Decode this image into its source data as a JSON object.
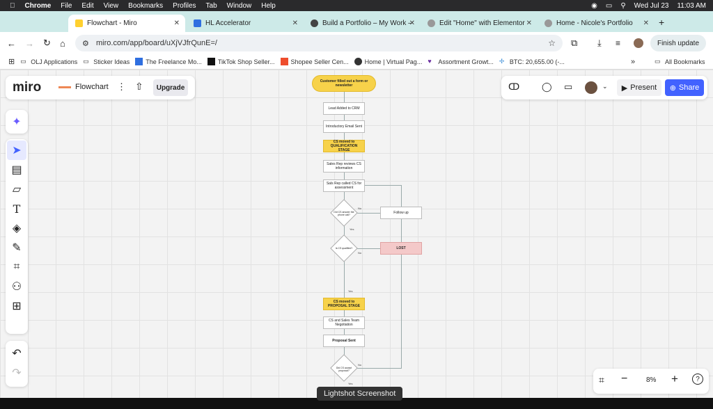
{
  "menubar": {
    "app": "Chrome",
    "items": [
      "File",
      "Edit",
      "View",
      "Bookmarks",
      "Profiles",
      "Tab",
      "Window",
      "Help"
    ],
    "date": "Wed Jul 23",
    "time": "11:03 AM"
  },
  "tabs": [
    {
      "label": "Flowchart - Miro",
      "color": "#ffd02f"
    },
    {
      "label": "HL Accelerator",
      "color": "#2f6fe0"
    },
    {
      "label": "Build a Portfolio – My Work –",
      "color": "#444"
    },
    {
      "label": "Edit \"Home\" with Elementor",
      "color": "#999"
    },
    {
      "label": "Home - Nicole's Portfolio",
      "color": "#999"
    }
  ],
  "toolbar": {
    "url": "miro.com/app/board/uXjVJfrQunE=/",
    "finish_label": "Finish update"
  },
  "bookmarks": [
    {
      "label": "OLJ Applications"
    },
    {
      "label": "Sticker Ideas"
    },
    {
      "label": "The Freelance Mo..."
    },
    {
      "label": "TikTok Shop Seller..."
    },
    {
      "label": "Shopee Seller Cen..."
    },
    {
      "label": "Home | Virtual Pag..."
    },
    {
      "label": "Assortment Growt..."
    },
    {
      "label": "BTC: 20,655.00 (-..."
    }
  ],
  "bookmarks_all": "All Bookmarks",
  "miro": {
    "logo": "miro",
    "board_name": "Flowchart",
    "upgrade": "Upgrade",
    "present": "Present",
    "share": "Share",
    "zoom": "8%"
  },
  "flow": {
    "start": "Customer filled out a form or newsletter",
    "n1": "Lead Added to CRM",
    "n2": "Introductory Email Sent",
    "n3": "CS moved to QUALIFICATION STAGE",
    "n4": "Sales Rep reviews CS information",
    "n5": "Sals Rep called CS for assessment",
    "d1": "Did CS answer the phone call?",
    "follow": "Follow up",
    "d2": "Is CS qualified?",
    "lost": "LOST",
    "n6": "CS moved to PROPOSAL STAGE",
    "n7": "CS and Sales Team Negotiation",
    "n8": "Proposal Sent",
    "d3": "Did CS accept proposal?",
    "no": "No",
    "yes": "Yes"
  },
  "tooltip": "Lightshot Screenshot"
}
